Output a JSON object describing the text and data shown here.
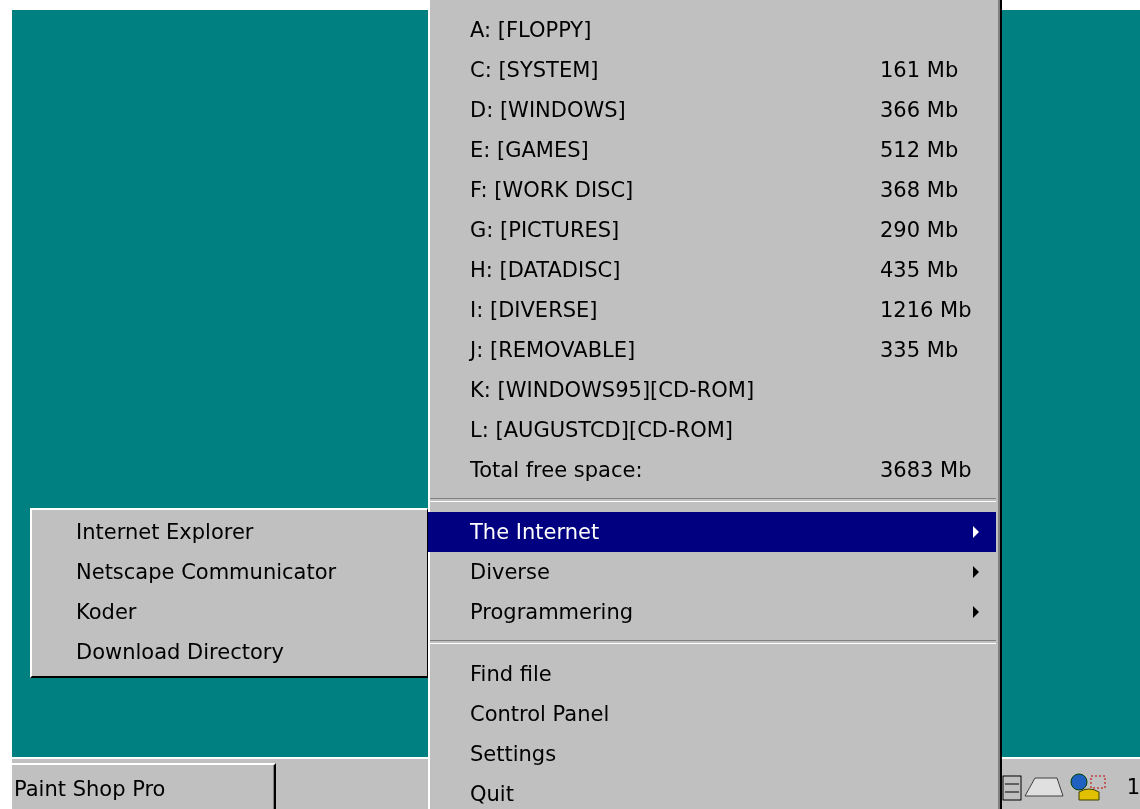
{
  "start_menu": {
    "drives": [
      {
        "label": "A: [FLOPPY]"
      },
      {
        "label": "C: [SYSTEM]",
        "size": "161 Mb"
      },
      {
        "label": "D: [WINDOWS]",
        "size": "366 Mb"
      },
      {
        "label": "E: [GAMES]",
        "size": "512 Mb"
      },
      {
        "label": "F: [WORK DISC]",
        "size": "368 Mb"
      },
      {
        "label": "G: [PICTURES]",
        "size": "290 Mb"
      },
      {
        "label": "H: [DATADISC]",
        "size": "435 Mb"
      },
      {
        "label": "I: [DIVERSE]",
        "size": "1216 Mb"
      },
      {
        "label": "J: [REMOVABLE]",
        "size": "335 Mb"
      },
      {
        "label": "K: [WINDOWS95][CD-ROM]"
      },
      {
        "label": "L: [AUGUSTCD][CD-ROM]"
      },
      {
        "label": "Total free space:",
        "size": "3683 Mb"
      }
    ],
    "folders": [
      {
        "label": "The Internet",
        "selected": true
      },
      {
        "label": "Diverse",
        "selected": false
      },
      {
        "label": "Programmering",
        "selected": false
      }
    ],
    "commands": [
      {
        "label": "Find file"
      },
      {
        "label": "Control Panel"
      },
      {
        "label": "Settings"
      },
      {
        "label": "Quit"
      }
    ]
  },
  "submenu": {
    "items": [
      {
        "label": "Internet Explorer"
      },
      {
        "label": "Netscape Communicator"
      },
      {
        "label": "Koder"
      },
      {
        "label": "Download Directory"
      }
    ]
  },
  "taskbar": {
    "buttons": [
      {
        "label": "Paint Shop Pro"
      }
    ],
    "clock": "1"
  }
}
